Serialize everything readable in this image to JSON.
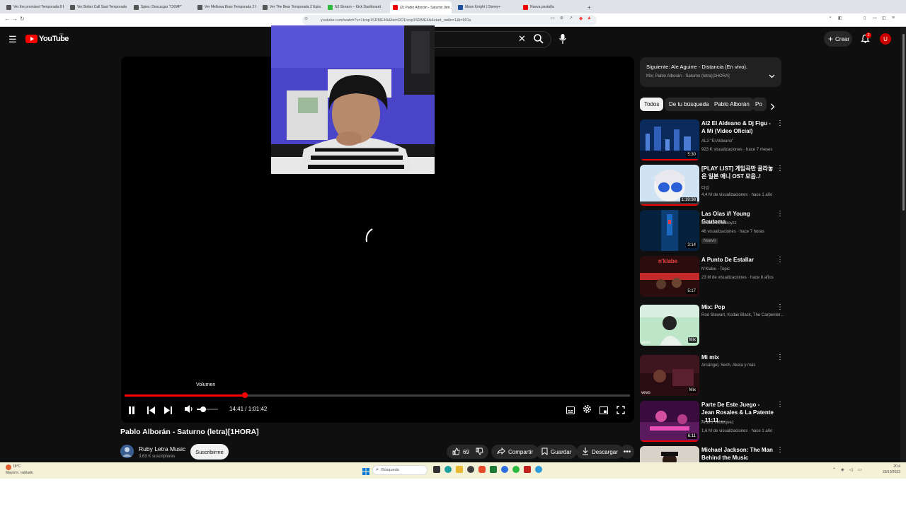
{
  "browser": {
    "tabs": [
      {
        "title": "Ver the promised Temporada 8 Ep...",
        "color": "#555"
      },
      {
        "title": "Ver Better Call Saul Temporada 2 Ep...",
        "color": "#555"
      },
      {
        "title": "Spies: Descargar \"CKMP\"",
        "color": "#555"
      },
      {
        "title": "Ver Mellowa Boss Temporada 2 Episo...",
        "color": "#555"
      },
      {
        "title": "Ver The Bear Temporada 2 Episodio...",
        "color": "#555"
      },
      {
        "title": "NJ Stream -- Kick Dashboard",
        "color": "#2bba3c"
      },
      {
        "title": "(2) Pablo Alborán - Saturno (letr...",
        "color": "#e00"
      },
      {
        "title": "Moon Knight | Disney+",
        "color": "#1a4fa3"
      },
      {
        "title": "Nueva pestaña",
        "color": "#e00"
      }
    ],
    "url": "youtube.com/watch?v=1Ivnp1SRME4A&list=RD1Ivnp1SRME4A&start_radio=1&t=901s"
  },
  "youtube": {
    "logo_text": "YouTube",
    "country_code": "PE",
    "create_label": "Crear",
    "notif_count": "2",
    "avatar_letter": "U"
  },
  "player": {
    "volume_tooltip": "Volumen",
    "time": "14:41 / 1:01:42",
    "progress_fraction": 0.238,
    "volume_fraction": 0.3
  },
  "video": {
    "title": "Pablo Alborán - Saturno (letra)[1HORA]",
    "channel": "Ruby Letra Music",
    "subscribers": "3,63 K suscriptores",
    "subscribe_label": "Suscribirme",
    "likes": "69",
    "share_label": "Compartir",
    "save_label": "Guardar",
    "download_label": "Descargar"
  },
  "queue": {
    "next": "Siguiente: Ale Aguirre - Distancia (En vivo).",
    "mix": "Mix: Pablo Alborán - Saturno (letra)[1HORA]"
  },
  "chips": [
    "Todos",
    "De tu búsqueda",
    "Pablo Alborán",
    "Po"
  ],
  "recs": [
    {
      "title": "AI2 El Aldeano & Dj Figu - A Mi (Video Oficial)",
      "channel": "AL2 \"El Aldeano\"",
      "meta": "923 K visualizaciones · hace 7 meses",
      "duration": "5:30"
    },
    {
      "title": "[PLAY LIST] 게임곡만 골라놓은 일본 애니 OST 모음..!",
      "channel": "타잉",
      "meta": "4,4 M de visualizaciones · hace 1 año",
      "duration": "1:19:38"
    },
    {
      "title": "Las Olas /// Young Gautama",
      "channel": "Buddahheadboyzz",
      "meta": "46 visualizaciones · hace 7 horas",
      "badge": "Nuevo",
      "duration": "3:14"
    },
    {
      "title": "A Punto De Estallar",
      "channel": "N'Klabe - Topic",
      "meta": "23 M de visualizaciones · hace 8 años",
      "duration": "5:17"
    },
    {
      "title": "Mix: Pop",
      "channel": "Rod Stewart, Kodak Black, The Carpenter...",
      "meta": "",
      "duration": "Mix"
    },
    {
      "title": "Mi mix",
      "channel": "Arcángel, Sech, Akela y más",
      "meta": "",
      "duration": "Mix"
    },
    {
      "title": "Parte De Este Juego - Jean Rosales & La Patente - 11:11 ...",
      "channel": "Arturo Velásquez",
      "meta": "1,6 M de visualizaciones · hace 1 año",
      "duration": "6:11"
    },
    {
      "title": "Michael Jackson: The Man Behind the Music",
      "channel": "",
      "meta": "",
      "duration": ""
    }
  ],
  "taskbar": {
    "weather_temp": "18°C",
    "weather_desc": "Mayorm. nublado",
    "search_placeholder": "Búsqueda",
    "time": "20:4",
    "date": "29/10/2023"
  }
}
